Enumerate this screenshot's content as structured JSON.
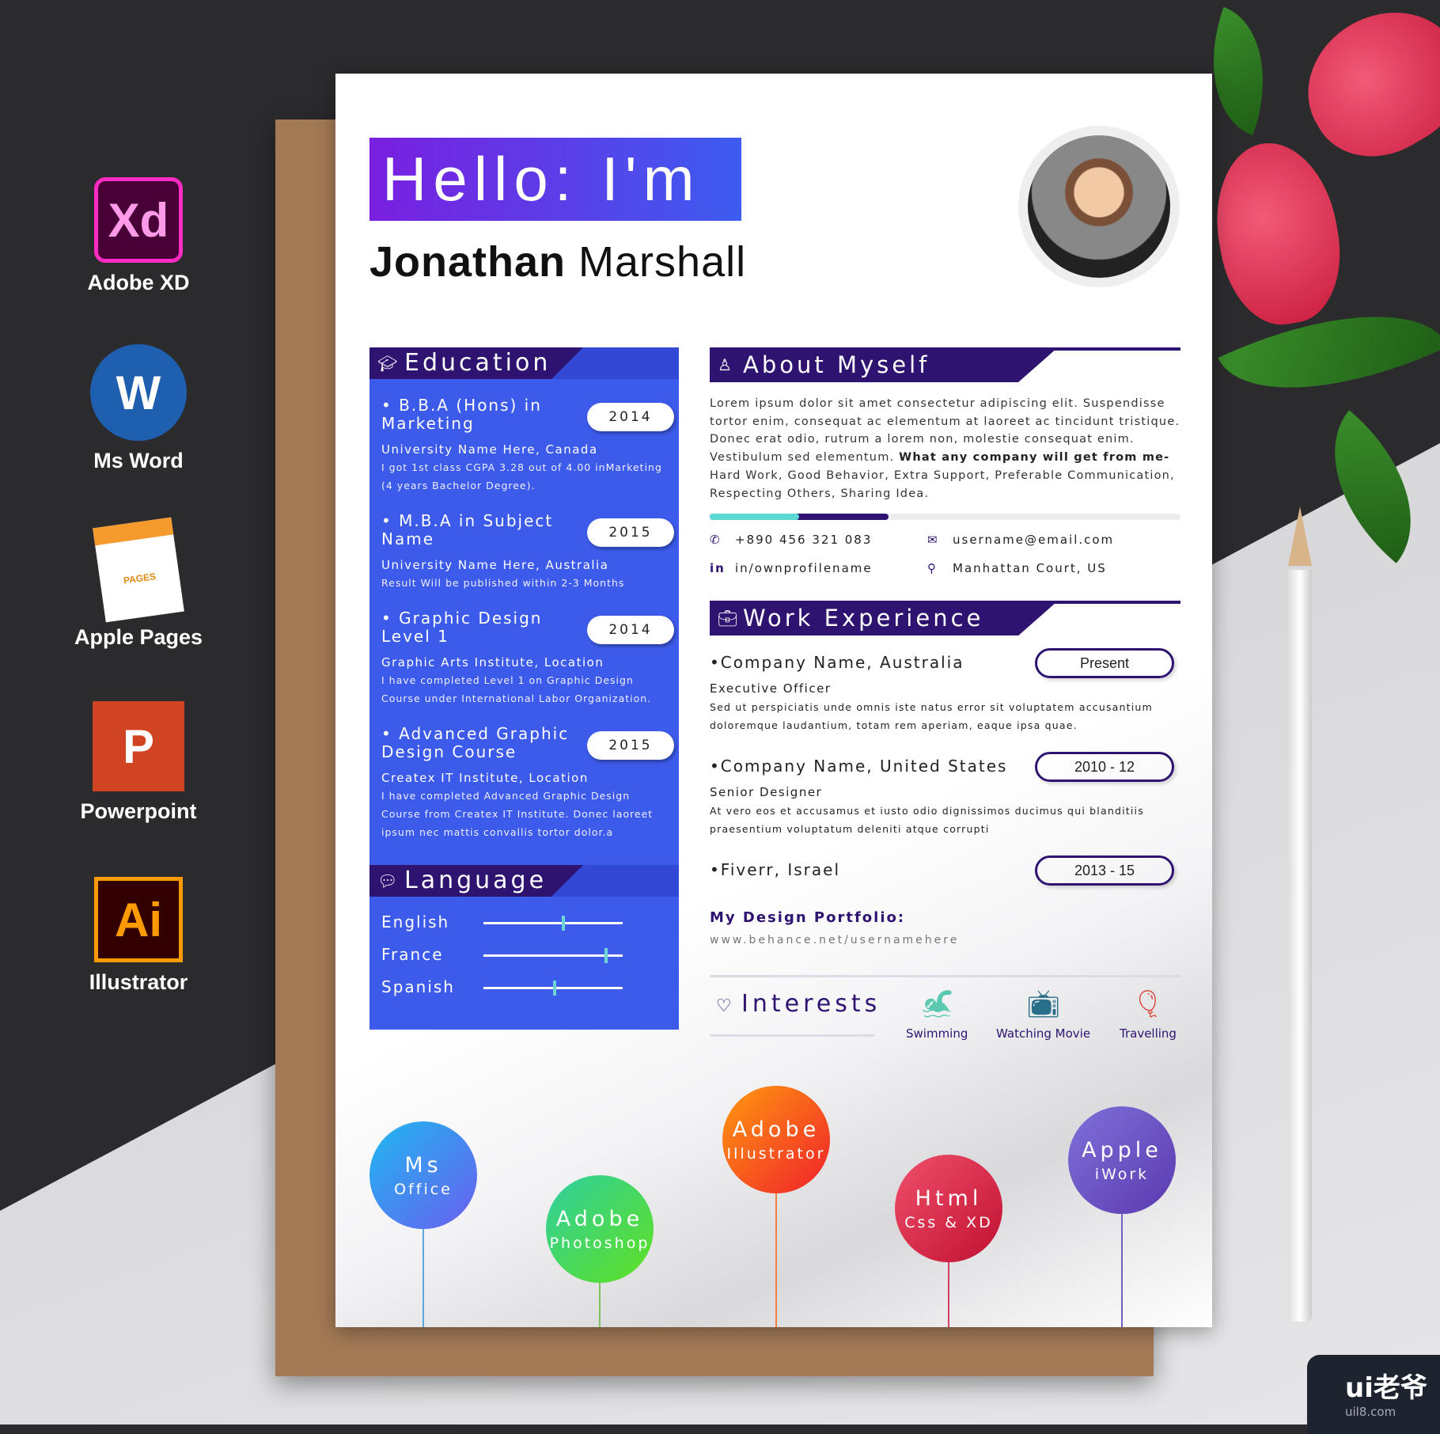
{
  "apps": [
    {
      "label": "Adobe XD",
      "glyph": "Xd",
      "icon": "adobe-xd-icon"
    },
    {
      "label": "Ms Word",
      "glyph": "W",
      "icon": "ms-word-icon"
    },
    {
      "label": "Apple Pages",
      "glyph": "PAGES",
      "icon": "apple-pages-icon"
    },
    {
      "label": "Powerpoint",
      "glyph": "P",
      "icon": "powerpoint-icon"
    },
    {
      "label": "Illustrator",
      "glyph": "Ai",
      "icon": "illustrator-icon"
    }
  ],
  "header": {
    "hello": "Hello: I'm",
    "first_name": "Jonathan",
    "last_name": "Marshall"
  },
  "education": {
    "title": "Education",
    "items": [
      {
        "title": "• B.B.A (Hons) in Marketing",
        "year": "2014",
        "school": "University Name Here, Canada",
        "desc": "I got 1st class CGPA 3.28 out of 4.00 inMarketing (4 years Bachelor Degree)."
      },
      {
        "title": "• M.B.A in Subject Name",
        "year": "2015",
        "school": "University Name Here, Australia",
        "desc": "Result Will be published within 2-3 Months"
      },
      {
        "title": "• Graphic Design Level 1",
        "year": "2014",
        "school": "Graphic Arts Institute, Location",
        "desc": "I have completed Level 1 on Graphic Design Course under International Labor Organization."
      },
      {
        "title": "• Advanced Graphic Design Course",
        "year": "2015",
        "school": "Createx IT Institute, Location",
        "desc": "I have completed Advanced Graphic Design Course from Createx IT Institute. Donec laoreet ipsum nec mattis convallis tortor dolor.a"
      }
    ]
  },
  "language": {
    "title": "Language",
    "items": [
      {
        "name": "English",
        "level": 0.56
      },
      {
        "name": "France",
        "level": 0.87
      },
      {
        "name": "Spanish",
        "level": 0.5
      }
    ]
  },
  "about": {
    "title": "About Myself",
    "text": "Lorem ipsum dolor sit amet consectetur adipiscing elit. Suspendisse tortor enim, consequat ac elementum at laoreet ac tincidunt tristique. Donec erat odio, rutrum a lorem non, molestie consequat enim. Vestibulum sed elementum. ",
    "bold": "What any company will get from me-",
    "text2": " Hard Work, Good Behavior, Extra Support, Preferable Communication, Respecting Others, Sharing Idea.",
    "progress_primary": 0.38,
    "progress_accent": 0.19,
    "colors": {
      "accent": "#5bd8d4",
      "primary": "#2e1370"
    }
  },
  "contacts": {
    "phone": "+890 456 321 083",
    "email": "username@email.com",
    "linkedin": "in/ownprofilename",
    "address": "Manhattan Court, US"
  },
  "work": {
    "title": "Work Experience",
    "items": [
      {
        "company": "Company Name, Australia",
        "date": "Present",
        "role": "Executive Officer",
        "desc": "Sed ut perspiciatis unde omnis iste natus error sit voluptatem accusantium doloremque laudantium, totam rem aperiam, eaque ipsa quae."
      },
      {
        "company": "Company Name, United States",
        "date": "2010 - 12",
        "role": "Senior Designer",
        "desc": "At vero eos et accusamus et iusto odio dignissimos ducimus qui blanditiis praesentium voluptatum deleniti atque corrupti"
      },
      {
        "company": "Fiverr, Israel",
        "date": "2013 - 15"
      }
    ]
  },
  "portfolio": {
    "label": "My Design Portfolio:",
    "url": "www.behance.net/usernamehere"
  },
  "interests": {
    "title": "Interests",
    "items": [
      {
        "label": "Swimming",
        "icon": "swimming-icon"
      },
      {
        "label": "Watching Movie",
        "icon": "tv-icon"
      },
      {
        "label": "Travelling",
        "icon": "hot-air-balloon-icon"
      }
    ]
  },
  "skills": [
    {
      "line1": "Ms",
      "line2": "Office"
    },
    {
      "line1": "Adobe",
      "line2": "Photoshop"
    },
    {
      "line1": "Adobe",
      "line2": "Illustrator"
    },
    {
      "line1": "Html",
      "line2": "Css & XD"
    },
    {
      "line1": "Apple",
      "line2": "iWork"
    }
  ],
  "watermark": {
    "logo": "ui老爷",
    "site": "uil8.com"
  }
}
